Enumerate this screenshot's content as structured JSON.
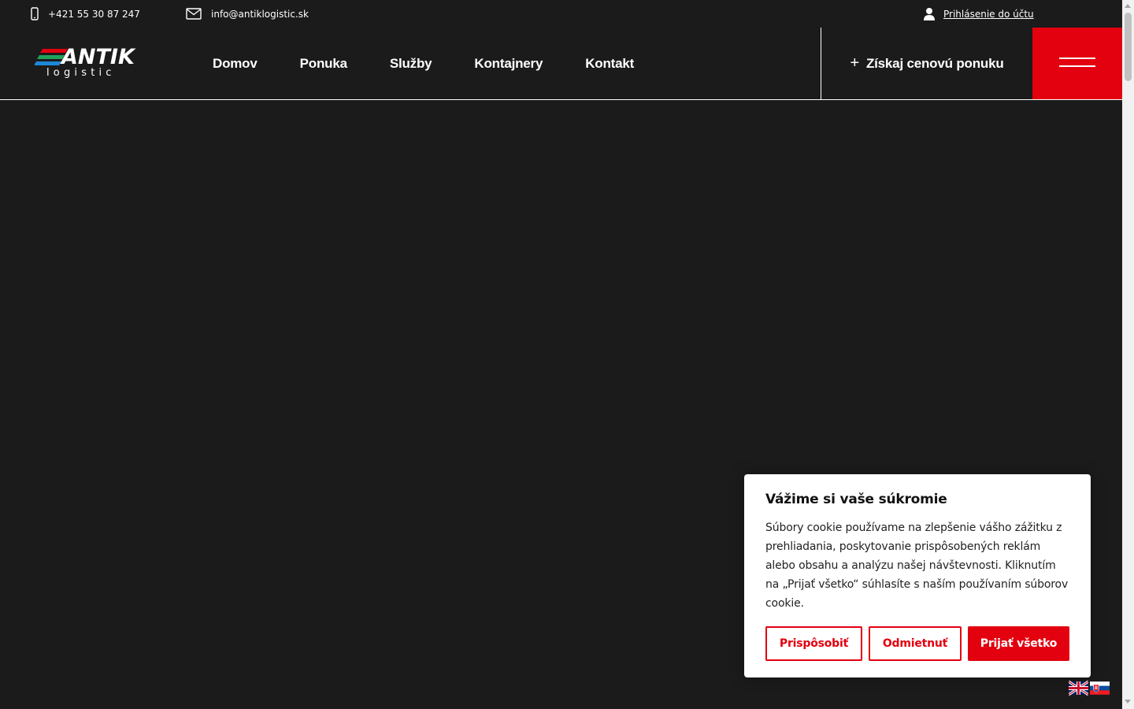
{
  "topbar": {
    "phone": "+421 55 30 87 247",
    "email": "info@antiklogistic.sk",
    "login": "Prihlásenie do účtu"
  },
  "logo": {
    "word": "ANTIK",
    "sub": "logistic"
  },
  "nav": {
    "items": [
      {
        "label": "Domov"
      },
      {
        "label": "Ponuka"
      },
      {
        "label": "Služby"
      },
      {
        "label": "Kontajnery"
      },
      {
        "label": "Kontakt"
      }
    ]
  },
  "header": {
    "quote_label": "Získaj cenovú ponuku",
    "quote_icon": "plus-icon",
    "menu_icon": "hamburger-menu-icon"
  },
  "cookie": {
    "title": "Vážime si vaše súkromie",
    "text": "Súbory cookie používame na zlepšenie vášho zážitku z prehliadania, poskytovanie prispôsobených reklám alebo obsahu a analýzu našej návštevnosti. Kliknutím na „Prijať všetko“ súhlasíte s naším používaním súborov cookie.",
    "customize_label": "Prispôsobiť",
    "reject_label": "Odmietnuť",
    "accept_label": "Prijať všetko"
  },
  "languages": [
    {
      "code": "en",
      "icon": "uk-flag-icon"
    },
    {
      "code": "sk",
      "icon": "slovakia-flag-icon"
    }
  ],
  "colors": {
    "background": "#1b1b1b",
    "accent": "#e3000f",
    "text": "#ffffff"
  }
}
